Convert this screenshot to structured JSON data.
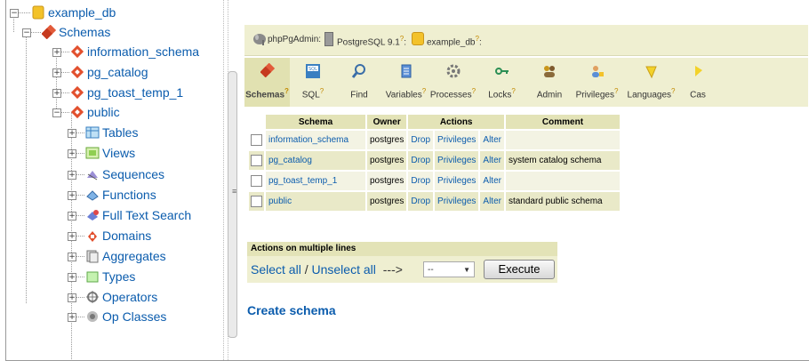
{
  "tree": {
    "items": [
      {
        "label": "example_db",
        "icon": "database-icon"
      },
      {
        "label": "Schemas",
        "icon": "schemas-icon"
      },
      {
        "label": "information_schema",
        "icon": "schema-icon"
      },
      {
        "label": "pg_catalog",
        "icon": "schema-icon"
      },
      {
        "label": "pg_toast_temp_1",
        "icon": "schema-icon"
      },
      {
        "label": "public",
        "icon": "schema-icon"
      },
      {
        "label": "Tables",
        "icon": "tables-icon"
      },
      {
        "label": "Views",
        "icon": "views-icon"
      },
      {
        "label": "Sequences",
        "icon": "sequences-icon"
      },
      {
        "label": "Functions",
        "icon": "functions-icon"
      },
      {
        "label": "Full Text Search",
        "icon": "fulltext-icon"
      },
      {
        "label": "Domains",
        "icon": "domains-icon"
      },
      {
        "label": "Aggregates",
        "icon": "aggregates-icon"
      },
      {
        "label": "Types",
        "icon": "types-icon"
      },
      {
        "label": "Operators",
        "icon": "operators-icon"
      },
      {
        "label": "Op Classes",
        "icon": "opclasses-icon"
      }
    ],
    "expander_collapsed": "+",
    "expander_expanded": "−"
  },
  "breadcrumb": {
    "app": "phpPgAdmin",
    "server": "PostgreSQL 9.1",
    "database": "example_db",
    "help": "?",
    "sep": ":"
  },
  "tabs": [
    {
      "label": "Schemas",
      "help": "?",
      "icon": "schemas-icon",
      "active": true
    },
    {
      "label": "SQL",
      "help": "?",
      "icon": "sql-icon"
    },
    {
      "label": "Find",
      "help": "",
      "icon": "find-icon"
    },
    {
      "label": "Variables",
      "help": "?",
      "icon": "variables-icon"
    },
    {
      "label": "Processes",
      "help": "?",
      "icon": "processes-icon"
    },
    {
      "label": "Locks",
      "help": "?",
      "icon": "locks-icon"
    },
    {
      "label": "Admin",
      "help": "",
      "icon": "admin-icon"
    },
    {
      "label": "Privileges",
      "help": "?",
      "icon": "privileges-icon"
    },
    {
      "label": "Languages",
      "help": "?",
      "icon": "languages-icon"
    },
    {
      "label": "Cas",
      "help": "",
      "icon": "casts-icon"
    }
  ],
  "table": {
    "headers": {
      "schema": "Schema",
      "owner": "Owner",
      "actions": "Actions",
      "comment": "Comment"
    },
    "rows": [
      {
        "schema": "information_schema",
        "owner": "postgres",
        "drop": "Drop",
        "privileges": "Privileges",
        "alter": "Alter",
        "comment": ""
      },
      {
        "schema": "pg_catalog",
        "owner": "postgres",
        "drop": "Drop",
        "privileges": "Privileges",
        "alter": "Alter",
        "comment": "system catalog schema"
      },
      {
        "schema": "pg_toast_temp_1",
        "owner": "postgres",
        "drop": "Drop",
        "privileges": "Privileges",
        "alter": "Alter",
        "comment": ""
      },
      {
        "schema": "public",
        "owner": "postgres",
        "drop": "Drop",
        "privileges": "Privileges",
        "alter": "Alter",
        "comment": "standard public schema"
      }
    ]
  },
  "multi": {
    "heading": "Actions on multiple lines",
    "select_all": "Select all",
    "slash": "/",
    "unselect_all": "Unselect all",
    "arrow": "--->",
    "select_value": "--",
    "execute": "Execute"
  },
  "create_schema": "Create schema",
  "colors": {
    "accent": "#0b5cad",
    "bar": "#efefd1",
    "header": "#e3e3b7"
  }
}
